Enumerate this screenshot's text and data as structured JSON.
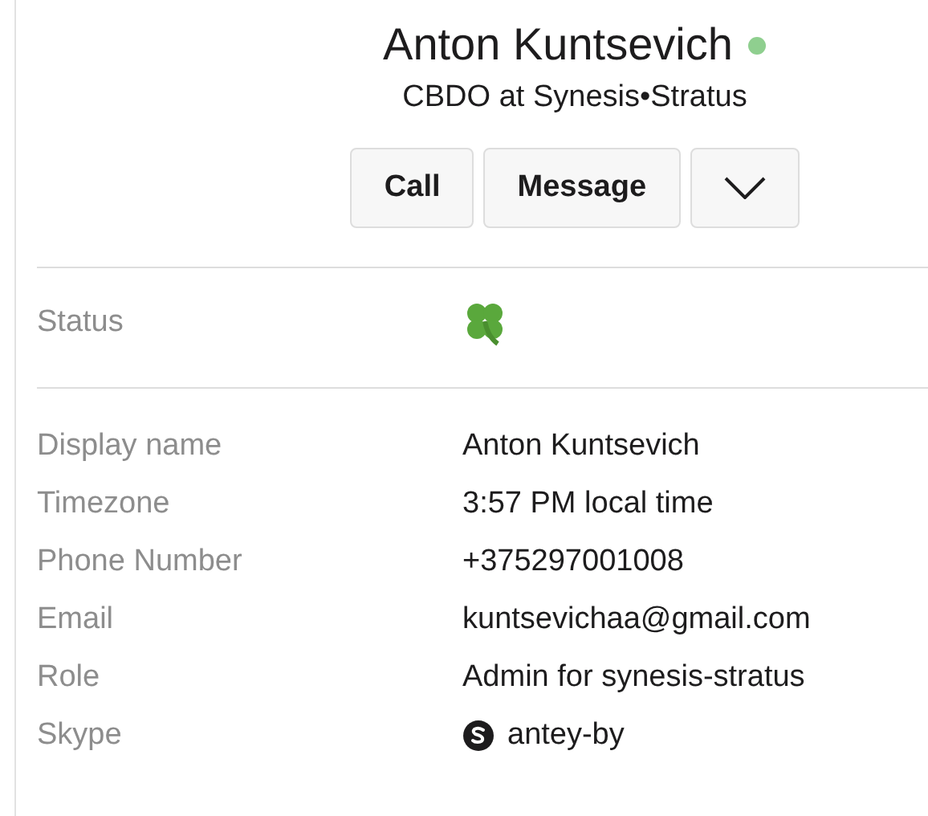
{
  "profile": {
    "name": "Anton Kuntsevich",
    "online": true,
    "title": "CBDO at Synesis•Stratus"
  },
  "actions": [
    {
      "kind": "text",
      "label": "Call"
    },
    {
      "kind": "text",
      "label": "Message"
    },
    {
      "kind": "menu"
    }
  ],
  "status": {
    "label": "Status"
  },
  "fields": [
    {
      "kind": "text",
      "label": "Display name",
      "value": "Anton Kuntsevich"
    },
    {
      "kind": "text",
      "label": "Timezone",
      "value": "3:57 PM local time"
    },
    {
      "kind": "text",
      "label": "Phone Number",
      "value": "+375297001008"
    },
    {
      "kind": "text",
      "label": "Email",
      "value": "kuntsevichaa@gmail.com"
    },
    {
      "kind": "text",
      "label": "Role",
      "value": "Admin for synesis-stratus"
    },
    {
      "kind": "skype",
      "label": "Skype",
      "value": "antey-by"
    }
  ]
}
